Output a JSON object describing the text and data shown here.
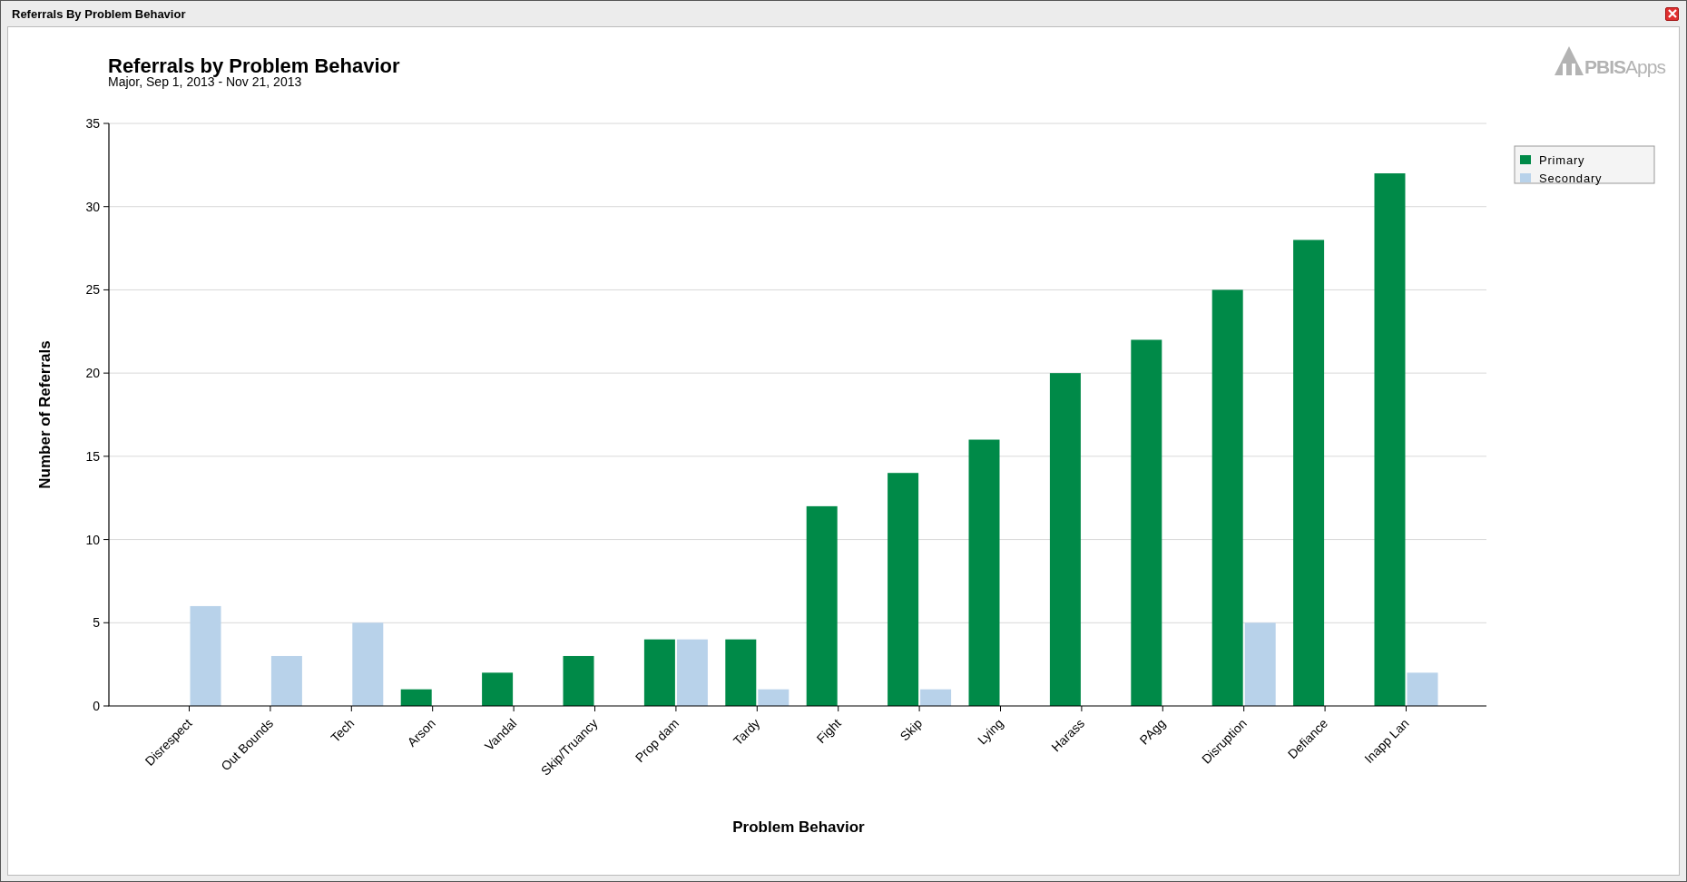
{
  "window": {
    "title": "Referrals By Problem Behavior"
  },
  "logo": {
    "text": "**PBIS**Apps"
  },
  "chart": {
    "subtitle": "Major, Sep 1, 2013 - Nov 21, 2013",
    "chart_data": {
      "type": "bar",
      "title": "Referrals by Problem Behavior",
      "xlabel": "Problem Behavior",
      "ylabel": "Number of Referrals",
      "categories": [
        "Disrespect",
        "Out Bounds",
        "Tech",
        "Arson",
        "Vandal",
        "Skip/Truancy",
        "Prop dam",
        "Tardy",
        "Fight",
        "Skip",
        "Lying",
        "Harass",
        "PAgg",
        "Disruption",
        "Defiance",
        "Inapp Lan"
      ],
      "series": [
        {
          "name": "Primary",
          "color": "#008a48",
          "values": [
            0,
            0,
            0,
            1,
            2,
            3,
            4,
            4,
            12,
            14,
            16,
            20,
            22,
            25,
            28,
            32
          ]
        },
        {
          "name": "Secondary",
          "color": "#b8d2ea",
          "values": [
            6,
            3,
            5,
            0,
            0,
            0,
            4,
            1,
            0,
            1,
            0,
            0,
            0,
            5,
            0,
            2
          ]
        }
      ],
      "grid": true,
      "legend": "right",
      "ylim": [
        0,
        35
      ],
      "yticks": [
        0,
        5,
        10,
        15,
        20,
        25,
        30,
        35
      ]
    }
  }
}
